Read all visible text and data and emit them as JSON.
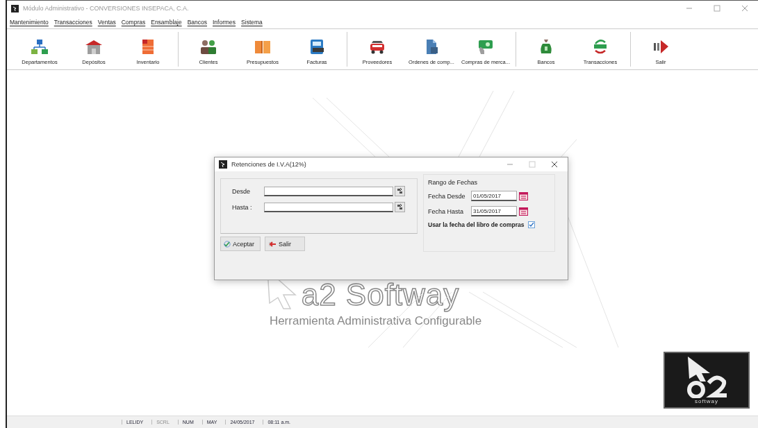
{
  "window": {
    "title": "Módulo Administrativo - CONVERSIONES INSEPACA, C.A."
  },
  "menu": [
    "Mantenimiento",
    "Transacciones",
    "Ventas",
    "Compras",
    "Ensamblaje",
    "Bancos",
    "Informes",
    "Sistema"
  ],
  "toolbar": [
    {
      "items": [
        "Departamentos",
        "Depósitos",
        "Inventario"
      ]
    },
    {
      "items": [
        "Clientes",
        "Presupuestos",
        "Facturas"
      ]
    },
    {
      "items": [
        "Proveedores",
        "Ordenes de comp...",
        "Compras de merca..."
      ]
    },
    {
      "items": [
        "Bancos",
        "Transacciones"
      ]
    },
    {
      "items": [
        "Salir"
      ]
    }
  ],
  "background": {
    "logo": "a2 Softway",
    "tagline": "Herramienta Administrativa Configurable",
    "badge": "softway"
  },
  "dialog": {
    "title": "Retenciones de I.V.A(12%)",
    "fields": [
      {
        "label": "Desde"
      },
      {
        "label": "Hasta :"
      }
    ],
    "date_range": {
      "title": "Rango de Fechas",
      "fields": [
        {
          "label": "Fecha Desde",
          "value": "01/05/2017"
        },
        {
          "label": "Fecha Hasta",
          "value": "31/05/2017"
        }
      ],
      "option": {
        "label": "Usar la fecha del libro de compras",
        "checked": true
      }
    },
    "buttons": [
      "Aceptar",
      "Salir"
    ]
  },
  "status_bar": [
    {
      "text": "LELIDY",
      "disabled": false
    },
    {
      "text": "SCRL",
      "disabled": true
    },
    {
      "text": "NUM",
      "disabled": false
    },
    {
      "text": "MAY",
      "disabled": false
    },
    {
      "text": "24/05/2017",
      "disabled": false
    },
    {
      "text": "08:11 a.m.",
      "disabled": false
    }
  ]
}
